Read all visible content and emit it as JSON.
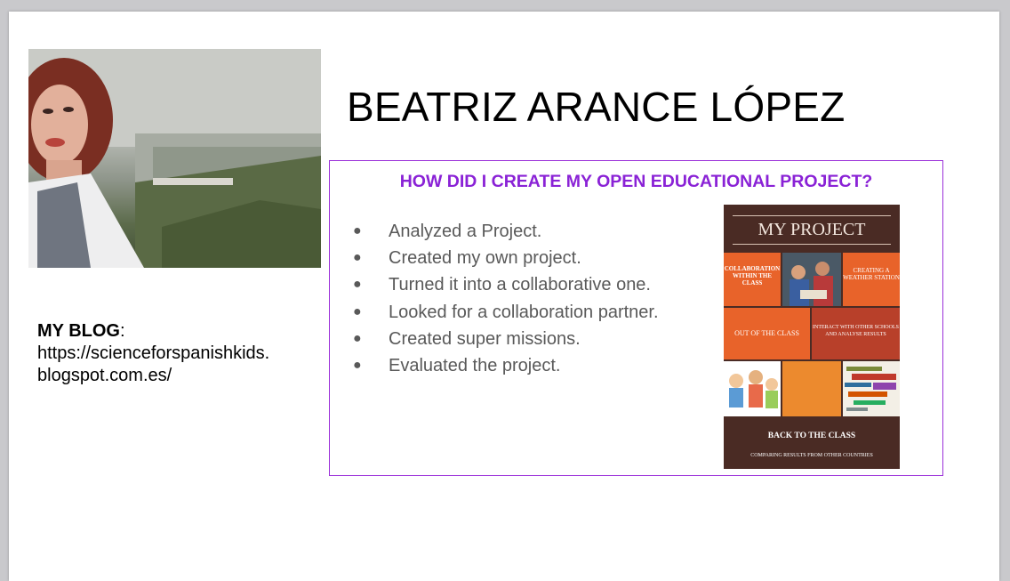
{
  "profile": {
    "name": "BEATRIZ ARANCE LÓPEZ",
    "photo_alt": "selfie-over-city"
  },
  "blog": {
    "label": "MY BLOG",
    "colon": ":",
    "url_line1": "https://scienceforspanishkids.",
    "url_line2": "blogspot.com.es/"
  },
  "project": {
    "heading": "HOW DID I CREATE MY OPEN EDUCATIONAL PROJECT?",
    "bullet": "●",
    "steps": [
      "Analyzed a Project.",
      "Created my own project.",
      "Turned it into a collaborative one.",
      "Looked for a collaboration partner.",
      "Created super missions.",
      "Evaluated the project."
    ]
  },
  "poster": {
    "title": "MY PROJECT",
    "collab": "COLLABORATION WITHIN THE CLASS",
    "weather": "CREATING A WEATHER STATION",
    "out": "OUT OF THE CLASS",
    "interact": "INTERACT WITH  OTHER SCHOOLS AND ANALYSE RESULTS",
    "back": "BACK TO THE CLASS",
    "comparing": "COMPARING RESULTS FROM OTHER COUNTRIES"
  },
  "colors": {
    "accent_purple": "#8a22d6",
    "box_border": "#9b30d9",
    "poster_brown": "#4a2b24",
    "poster_orange": "#e8632a",
    "poster_red": "#b8402a"
  }
}
